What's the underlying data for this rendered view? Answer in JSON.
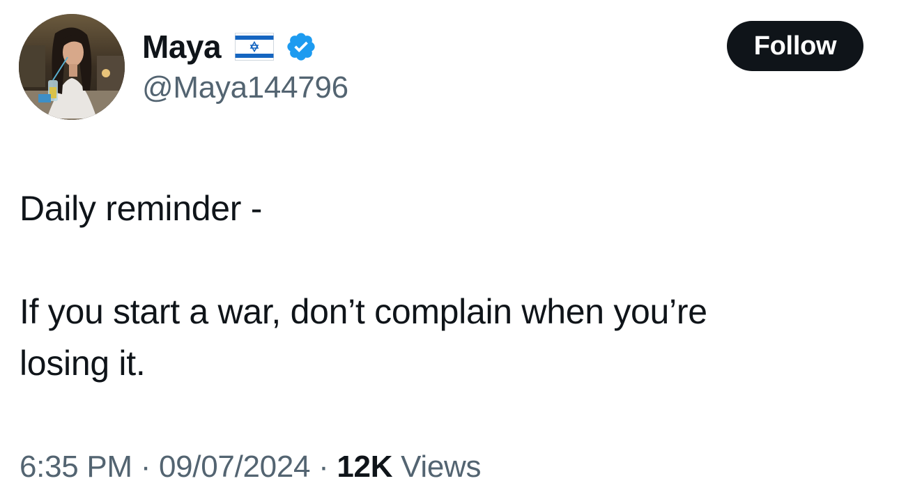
{
  "author": {
    "name": "Maya",
    "handle": "@Maya144796",
    "flag_icon": "israel-flag-icon",
    "verified_icon": "verified-badge-icon",
    "verified_color": "#1d9bf0"
  },
  "follow_label": "Follow",
  "tweet": {
    "line1": "Daily reminder -",
    "line2": "If you start a war, don’t complain when you’re",
    "line3": "losing it."
  },
  "meta": {
    "time": "6:35 PM",
    "sep1": " · ",
    "date": "09/07/2024",
    "sep2": " · ",
    "views_count": "12K",
    "views_label": " Views"
  },
  "colors": {
    "text": "#0f1419",
    "secondary": "#536471",
    "button_bg": "#0f1419",
    "button_text": "#ffffff"
  }
}
